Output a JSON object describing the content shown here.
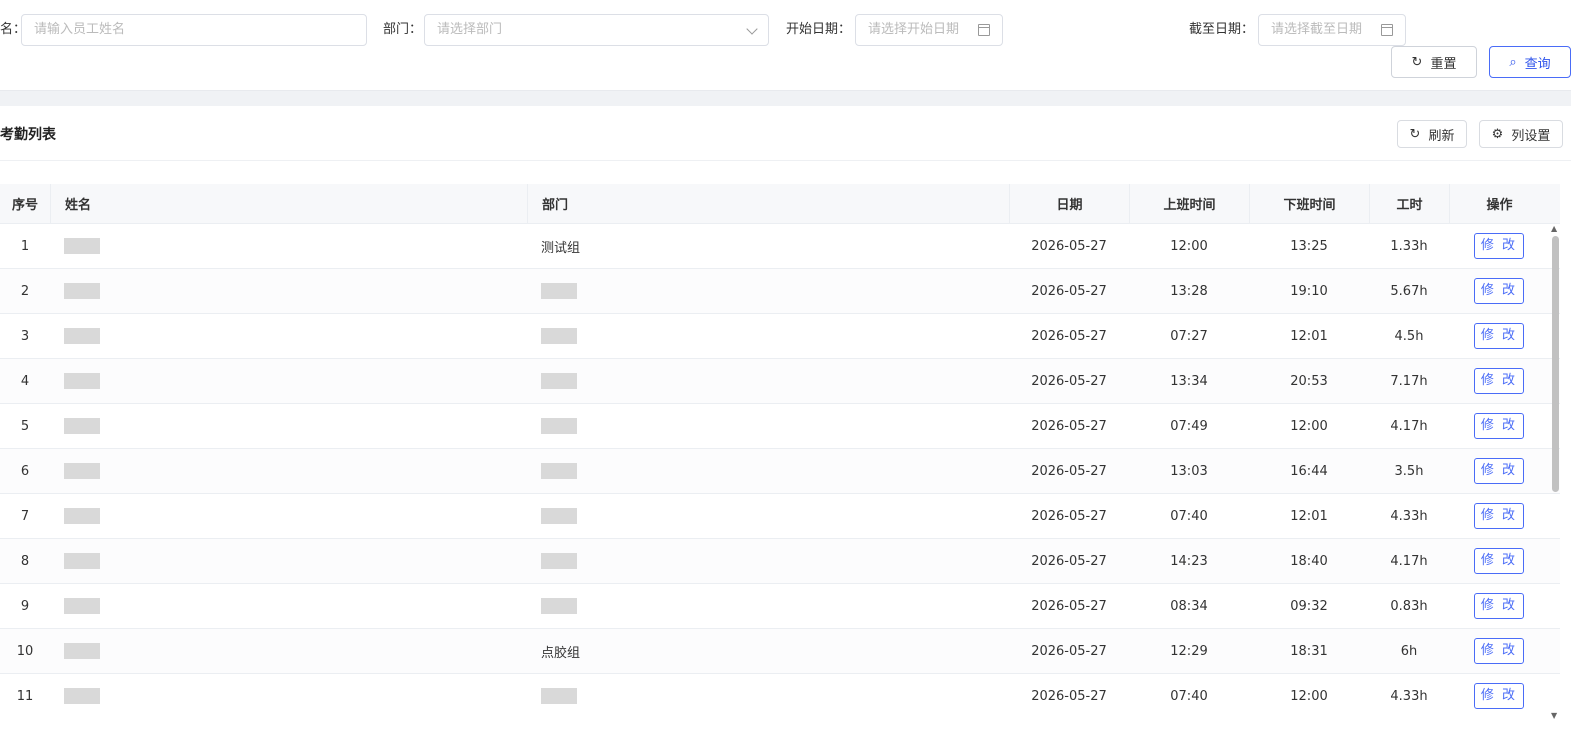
{
  "search": {
    "name_label": "名：",
    "name_placeholder": "请输入员工姓名",
    "dept_label": "部门：",
    "dept_placeholder": "请选择部门",
    "start_label": "开始日期：",
    "start_placeholder": "请选择开始日期",
    "end_label": "截至日期：",
    "end_placeholder": "请选择截至日期",
    "reset_label": "重置",
    "query_label": "查询"
  },
  "table_panel": {
    "title": "考勤列表",
    "refresh_label": "刷新",
    "columns_label": "列设置"
  },
  "table": {
    "headers": [
      "序号",
      "姓名",
      "部门",
      "日期",
      "上班时间",
      "下班时间",
      "工时",
      "操作"
    ],
    "edit_label": "修 改",
    "rows": [
      {
        "idx": "1",
        "name": "",
        "dept": "测试组",
        "date": "2026-05-27",
        "in": "12:00",
        "out": "13:25",
        "hours": "1.33h"
      },
      {
        "idx": "2",
        "name": "",
        "dept": "",
        "date": "2026-05-27",
        "in": "13:28",
        "out": "19:10",
        "hours": "5.67h"
      },
      {
        "idx": "3",
        "name": "",
        "dept": "",
        "date": "2026-05-27",
        "in": "07:27",
        "out": "12:01",
        "hours": "4.5h"
      },
      {
        "idx": "4",
        "name": "",
        "dept": "",
        "date": "2026-05-27",
        "in": "13:34",
        "out": "20:53",
        "hours": "7.17h"
      },
      {
        "idx": "5",
        "name": "",
        "dept": "",
        "date": "2026-05-27",
        "in": "07:49",
        "out": "12:00",
        "hours": "4.17h"
      },
      {
        "idx": "6",
        "name": "",
        "dept": "",
        "date": "2026-05-27",
        "in": "13:03",
        "out": "16:44",
        "hours": "3.5h"
      },
      {
        "idx": "7",
        "name": "",
        "dept": "",
        "date": "2026-05-27",
        "in": "07:40",
        "out": "12:01",
        "hours": "4.33h"
      },
      {
        "idx": "8",
        "name": "",
        "dept": "",
        "date": "2026-05-27",
        "in": "14:23",
        "out": "18:40",
        "hours": "4.17h"
      },
      {
        "idx": "9",
        "name": "",
        "dept": "",
        "date": "2026-05-27",
        "in": "08:34",
        "out": "09:32",
        "hours": "0.83h"
      },
      {
        "idx": "10",
        "name": "",
        "dept": "点胶组",
        "date": "2026-05-27",
        "in": "12:29",
        "out": "18:31",
        "hours": "6h"
      },
      {
        "idx": "11",
        "name": "",
        "dept": "",
        "date": "2026-05-27",
        "in": "07:40",
        "out": "12:00",
        "hours": "4.33h"
      }
    ]
  },
  "colors": {
    "primary": "#4a6cf7",
    "header_bg": "#f7f8fa"
  }
}
